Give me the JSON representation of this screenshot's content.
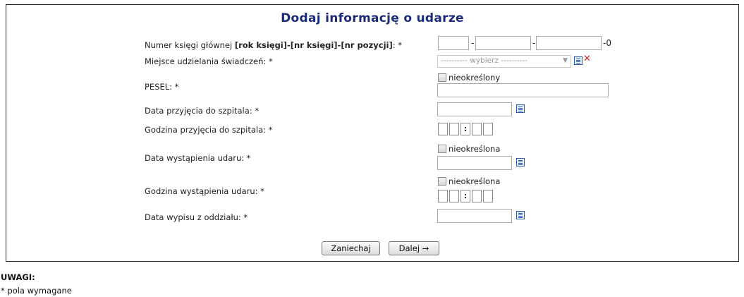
{
  "form": {
    "title": "Dodaj informację o udarze",
    "book_number": {
      "label_prefix": "Numer księgi głównej ",
      "label_bold": "[rok księgi]-[nr księgi]-[nr pozycji]",
      "label_suffix": ": *",
      "separator": "-",
      "suffix": "-0"
    },
    "place": {
      "label": "Miejsce udzielania świadczeń: *",
      "select_value": "---------- wybierz ----------"
    },
    "pesel": {
      "label": "PESEL: *",
      "checkbox_label": "nieokreślony"
    },
    "admission_date": {
      "label": "Data przyjęcia do szpitala: *"
    },
    "admission_time": {
      "label": "Godzina przyjęcia do szpitala: *",
      "colon": ":"
    },
    "stroke_date": {
      "label": "Data wystąpienia udaru: *",
      "checkbox_label": "nieokreślona"
    },
    "stroke_time": {
      "label": "Godzina wystąpienia udaru: *",
      "checkbox_label": "nieokreślona",
      "colon": ":"
    },
    "discharge_date": {
      "label": "Data wypisu z oddziału: *"
    }
  },
  "buttons": {
    "cancel": "Zaniechaj",
    "next": "Dalej →"
  },
  "notes": {
    "title": "UWAGI:",
    "required": "* pola wymagane"
  },
  "icons": {
    "calendar": "calendar-icon",
    "clear": "clear-x-icon",
    "list": "list-icon"
  },
  "colors": {
    "title": "#1c2d77",
    "clear": "#dd2222",
    "icon": "#2d5bb0"
  }
}
